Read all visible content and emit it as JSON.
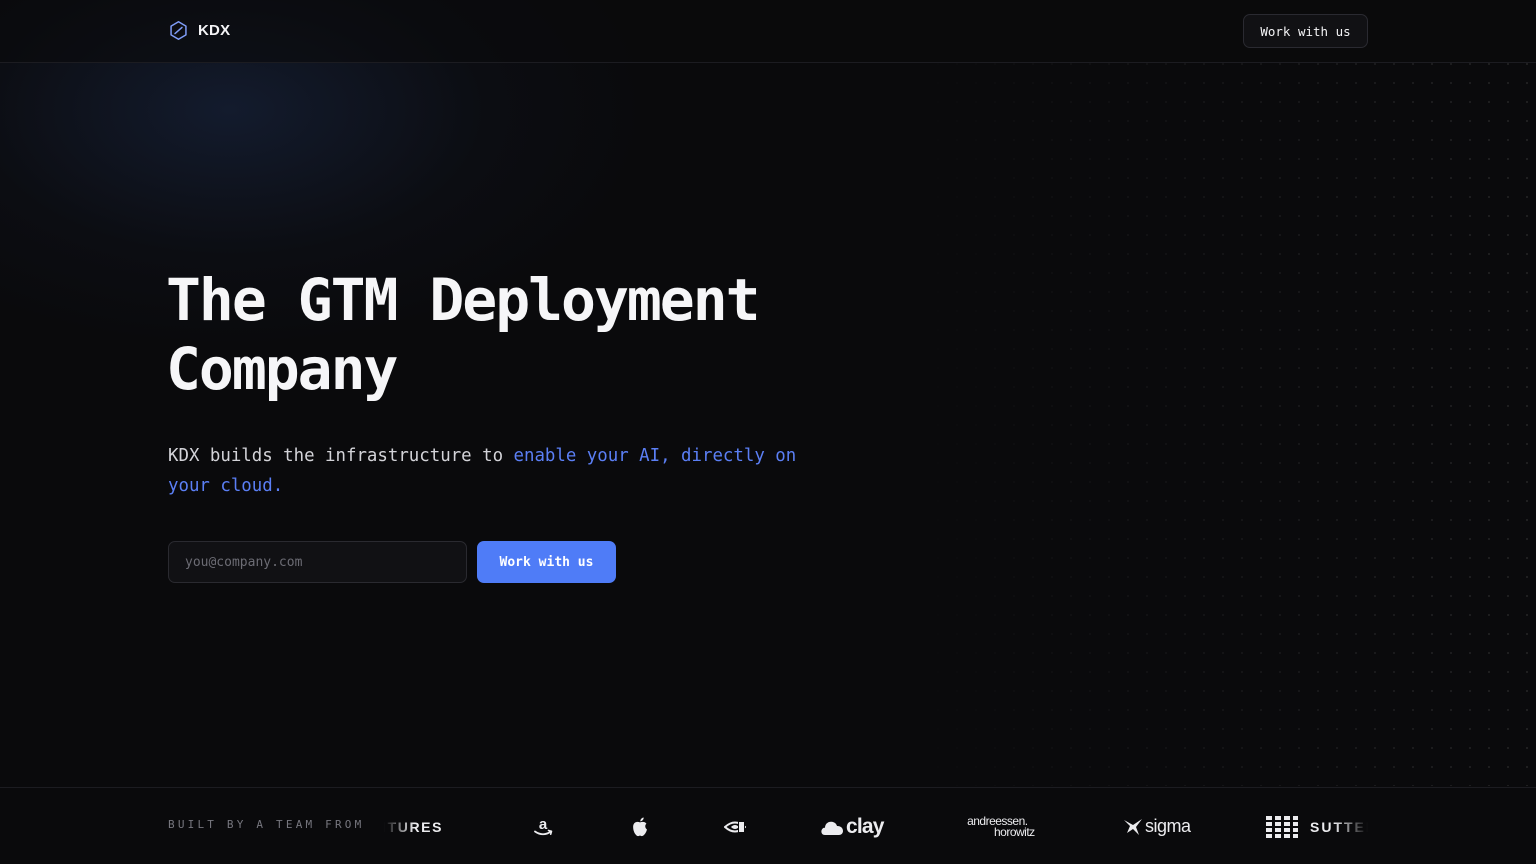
{
  "header": {
    "brand_name": "KDX",
    "cta_label": "Work with us"
  },
  "hero": {
    "title_line1": "The GTM Deployment",
    "title_line2": "Company",
    "subtitle_plain": "KDX builds the infrastructure to ",
    "subtitle_accent": "enable your AI, directly on your cloud.",
    "email_placeholder": "you@company.com",
    "email_value": "",
    "cta_label": "Work with us"
  },
  "logos_bar": {
    "label": "BUILT BY A TEAM FROM",
    "logos": [
      {
        "name": "ventures",
        "text": "VENTURES"
      },
      {
        "name": "amazon",
        "icon": "amazon-logo-icon"
      },
      {
        "name": "apple",
        "icon": "apple-logo-icon"
      },
      {
        "name": "nvidia",
        "icon": "nvidia-logo-icon"
      },
      {
        "name": "clay",
        "text": "clay",
        "icon": "cloud-icon"
      },
      {
        "name": "andreessen-horowitz",
        "text_line1": "andreessen.",
        "text_line2": "horowitz"
      },
      {
        "name": "sigma",
        "text": "sigma",
        "icon": "sigma-bird-icon"
      },
      {
        "name": "sutter",
        "text": "SUTTER",
        "icon": "grid-icon"
      }
    ]
  },
  "colors": {
    "background": "#0a0a0c",
    "accent": "#5b7ff5",
    "primary_button": "#4f7cf7",
    "text": "#f6f6f8",
    "muted": "#77777f"
  }
}
